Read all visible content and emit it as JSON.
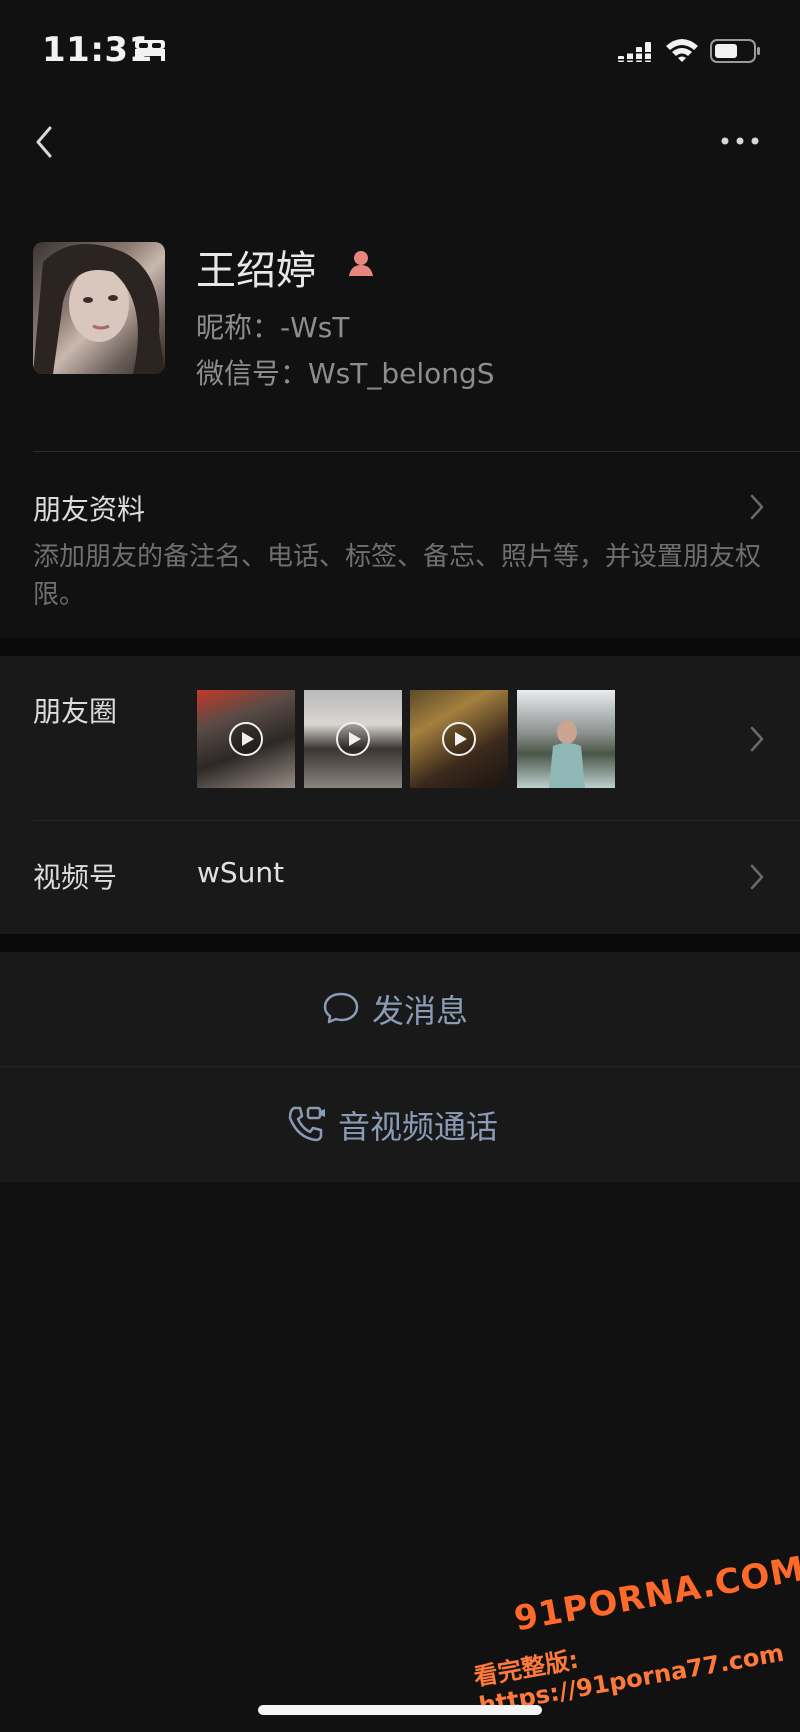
{
  "status_bar": {
    "time": "11:31"
  },
  "profile": {
    "name": "王绍婷",
    "nickname": "昵称：-WsT",
    "wechat_id": "微信号：WsT_belongS"
  },
  "friend_info": {
    "title": "朋友资料",
    "description": "添加朋友的备注名、电话、标签、备忘、照片等，并设置朋友权限。"
  },
  "moments": {
    "label": "朋友圈",
    "thumbnails": [
      {
        "type": "video"
      },
      {
        "type": "video"
      },
      {
        "type": "video"
      },
      {
        "type": "photo"
      }
    ]
  },
  "channels": {
    "label": "视频号",
    "value": "wSunt"
  },
  "actions": {
    "message_label": "发消息",
    "call_label": "音视频通话"
  },
  "watermark": {
    "main": "91PORNA.COM",
    "sub": "看完整版: https://91porna77.com"
  },
  "colors": {
    "background": "#111111",
    "panel": "#191919",
    "action_text": "#8a9bb5",
    "gender_icon": "#e8857f"
  }
}
